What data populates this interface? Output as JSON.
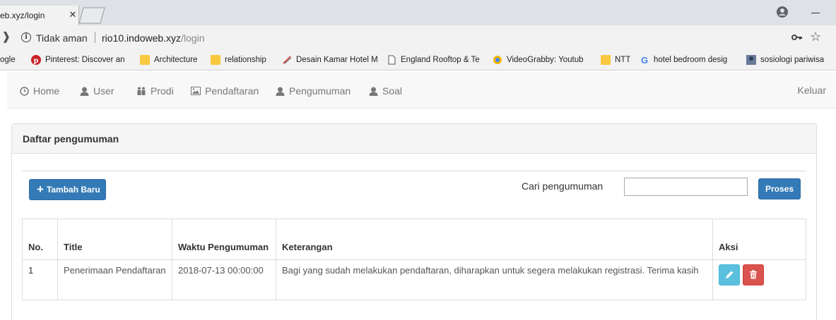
{
  "browser": {
    "tab_title": "eb.xyz/login",
    "tab_close": "✕",
    "security_label": "Tidak aman",
    "url_host": "rio10.indoweb.xyz",
    "url_path": "/login",
    "bookmarks": [
      {
        "label": "ogle",
        "icon": "google-partial-icon"
      },
      {
        "label": "Pinterest: Discover an",
        "icon": "pinterest-icon"
      },
      {
        "label": "Architecture",
        "icon": "folder-icon"
      },
      {
        "label": "relationship",
        "icon": "folder-icon"
      },
      {
        "label": "Desain Kamar Hotel M",
        "icon": "pen-icon"
      },
      {
        "label": "England Rooftop & Te",
        "icon": "page-icon"
      },
      {
        "label": "VideoGrabby: Youtub",
        "icon": "videograbby-icon"
      },
      {
        "label": "NTT",
        "icon": "folder-icon"
      },
      {
        "label": "hotel bedroom desig",
        "icon": "google-icon"
      },
      {
        "label": "sosiologi pariwisa",
        "icon": "image-icon"
      }
    ]
  },
  "navbar": {
    "items": [
      {
        "label": "Home",
        "icon": "clock-icon"
      },
      {
        "label": "User",
        "icon": "user-icon"
      },
      {
        "label": "Prodi",
        "icon": "group-icon"
      },
      {
        "label": "Pendaftaran",
        "icon": "picture-icon"
      },
      {
        "label": "Pengumuman",
        "icon": "user-icon"
      },
      {
        "label": "Soal",
        "icon": "user-icon"
      }
    ],
    "logout_label": "Keluar"
  },
  "panel": {
    "title": "Daftar pengumuman",
    "add_button": "Tambah Baru",
    "add_button_icon": "+",
    "search_label": "Cari pengumuman",
    "search_value": "",
    "search_button": "Proses"
  },
  "table": {
    "headers": [
      "No.",
      "Title",
      "Waktu Pengumuman",
      "Keterangan",
      "Aksi"
    ],
    "rows": [
      {
        "no": "1",
        "title": "Penerimaan Pendaftaran",
        "waktu": "2018-07-13 00:00:00",
        "keterangan": "Bagi yang sudah melakukan pendaftaran, diharapkan untuk segera melakukan registrasi. Terima kasih"
      }
    ]
  },
  "colors": {
    "primary": "#337ab7",
    "info": "#5bc0de",
    "danger": "#d9534f"
  }
}
